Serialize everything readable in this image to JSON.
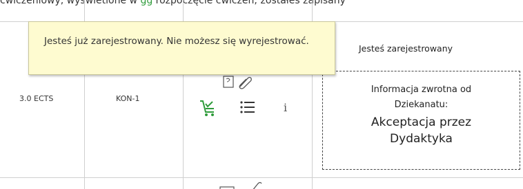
{
  "top_strip": {
    "text_left": "ćwiczeniowy, wyświetlone w",
    "text_green": "gg",
    "text_right": "rozpoczęcie ćwiczeń; zostałeś zapisany"
  },
  "row": {
    "ects": "3.0 ECTS",
    "code": "KON-1",
    "status": "Jesteś zarejestrowany",
    "feedback_label": "Informacja zwrotna od Dziekanatu:",
    "feedback_value": "Akceptacja przez Dydaktyka"
  },
  "tooltip": {
    "text": "Jesteś już zarejestrowany. Nie możesz się wyrejestrować."
  },
  "icons": {
    "document": "document-icon",
    "attachment": "paperclip-icon",
    "cart": "cart-check-icon",
    "list": "list-icon",
    "info": "i",
    "colors": {
      "cart_green": "#2e9b3a",
      "tooltip_bg": "#fefbd0"
    }
  }
}
